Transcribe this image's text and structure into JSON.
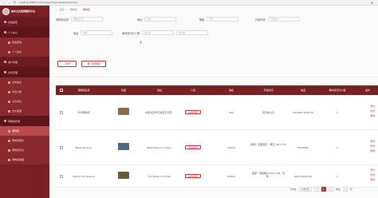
{
  "browser": {
    "url": "localhost:8080/xxx/front/pages/wenhuachanye/list.html",
    "nav_icons": [
      "←",
      "→",
      "↻"
    ],
    "close_glyph": "✕"
  },
  "sidebar": {
    "app_title": "城市文化旅游服务平台",
    "items": [
      {
        "label": "系统首页",
        "type": "group"
      },
      {
        "label": "个人中心",
        "type": "group"
      },
      {
        "label": "修改密码",
        "type": "sub"
      },
      {
        "label": "个人信息",
        "type": "sub"
      },
      {
        "label": "用户管理",
        "type": "group"
      },
      {
        "label": "文化管理",
        "type": "group"
      },
      {
        "label": "文化信息",
        "type": "sub"
      },
      {
        "label": "文化分类",
        "type": "sub"
      },
      {
        "label": "文化评论",
        "type": "sub"
      },
      {
        "label": "文化收藏",
        "type": "sub"
      },
      {
        "label": "博物馆管理",
        "type": "group"
      },
      {
        "label": "博物馆",
        "type": "sub",
        "active": true
      },
      {
        "label": "博物馆预约",
        "type": "sub"
      },
      {
        "label": "博物馆评论",
        "type": "sub"
      },
      {
        "label": "博物馆收藏",
        "type": "sub"
      }
    ]
  },
  "breadcrumb": {
    "home": "首页",
    "sep": "/",
    "section": "博物馆",
    "current": "博物馆"
  },
  "filters": {
    "name_label": "博物馆名称",
    "name_placeholder": "博物馆名称",
    "address_label": "地址",
    "address_placeholder": "地址",
    "grade_label": "等级",
    "grade_placeholder": "等级",
    "opening_label": "开放时间",
    "opening_placeholder": "开放时间",
    "phone_label": "电话",
    "phone_placeholder": "电话",
    "count_label": "每时段可约人数",
    "count_placeholder": "最小值",
    "count_to": "至",
    "count_max_placeholder": "最大值"
  },
  "buttons": {
    "add": "+ 新增",
    "batch_delete": "批量删除"
  },
  "table": {
    "headers": [
      "博物馆名称",
      "封面",
      "地址",
      "介绍",
      "等级",
      "开放时间",
      "电话",
      "每时段可约人数",
      "操作"
    ],
    "rows": [
      {
        "name": "宁海博物馆",
        "address": "中国北京市东城区东长安...",
        "intro": "内容详情",
        "grade": "AAA",
        "hours": "周日休之日",
        "phone": "010-8524-1155-166",
        "count": "6",
        "actions": [
          "预约",
          "修改",
          "删除"
        ],
        "thumb_color": "#8a6a4a"
      },
      {
        "name": "British Museum",
        "address": "British Museum, Great...",
        "intro": "内容详情",
        "grade": "AAAAA",
        "hours": "星期一至星期日，每天7:00-17:00",
        "phone": "85415555",
        "count": "5",
        "actions": [
          "预约",
          "修改",
          "删除"
        ],
        "thumb_color": "#4a6a8a"
      },
      {
        "name": "Virginia City Museum",
        "address": "The Museum in Paris",
        "intro": "内容详情",
        "grade": "AAAAA",
        "hours": "星期一至星期五9:00-17:00，周末...",
        "phone": "0222-101001-69",
        "count": "2",
        "actions": [
          "预约",
          "修改",
          "删除"
        ],
        "thumb_color": "#6a5a3a"
      }
    ]
  },
  "pagination": {
    "total": "共3条",
    "size": "10条/页",
    "prev": "<",
    "page": "1",
    "next": ">",
    "goto": "前往",
    "goto_page": "1",
    "page_unit": "页"
  }
}
